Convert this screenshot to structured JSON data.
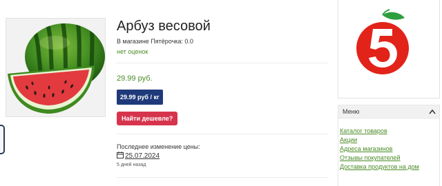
{
  "product": {
    "title": "Арбуз весовой",
    "store_rating": "В магазине Пятёрочка: 0.0",
    "rating_status": "нет оценок",
    "price": "29.99 руб.",
    "unit_price": "29.99 руб / кг",
    "find_cheaper_label": "Найти дешевле?",
    "last_change_label": "Последнее изменение цены:",
    "last_change_date": "25.07.2024",
    "days_ago": "5 дней назад"
  },
  "sidebar": {
    "logo_icon": "pyaterochka-logo",
    "menu_title": "Меню",
    "menu_items": [
      {
        "label": "Каталог товаров"
      },
      {
        "label": "Акции"
      },
      {
        "label": "Адреса магазинов"
      },
      {
        "label": "Отзывы покупателей"
      },
      {
        "label": "Доставка продуктов на дом"
      }
    ]
  },
  "colors": {
    "price_green": "#4a8a25",
    "unit_badge_bg": "#1f3a7a",
    "cheaper_button_bg": "#d6344d",
    "logo_red": "#e2231a",
    "logo_green": "#2f9e3f"
  }
}
